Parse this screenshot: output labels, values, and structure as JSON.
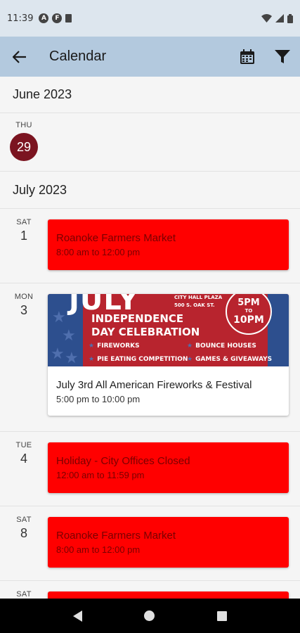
{
  "status": {
    "time": "11:39",
    "icons": [
      "a-icon",
      "f-icon",
      "sim-icon"
    ],
    "right_icons": [
      "wifi-icon",
      "signal-icon",
      "battery-icon"
    ]
  },
  "app_bar": {
    "title": "Calendar",
    "icons": [
      "back-arrow-icon",
      "calendar-icon",
      "filter-icon"
    ]
  },
  "colors": {
    "app_bar": "#b3c9de",
    "today": "#7b1420",
    "event": "#ff0000",
    "event_text": "#7a0000"
  },
  "june": {
    "month": "June 2023",
    "days": [
      {
        "dow": "THU",
        "day": "29",
        "today": true
      }
    ]
  },
  "july": {
    "month": "July 2023",
    "days": [
      {
        "dow": "SAT",
        "day": "1",
        "events": [
          {
            "title": "Roanoke Farmers Market",
            "time": "8:00 am to 12:00 pm"
          }
        ]
      },
      {
        "dow": "MON",
        "day": "3",
        "events": [
          {
            "title": "July 3rd All American Fireworks & Festival",
            "time": "5:00 pm to 10:00 pm",
            "banner": {
              "big": "JULY",
              "line1": "INDEPENDENCE",
              "line2": "DAY CELEBRATION",
              "location1": "CITY HALL PLAZA",
              "location2": "500 S. OAK ST.",
              "time_top": "5PM",
              "time_mid": "TO",
              "time_bot": "10PM",
              "items": [
                "FIREWORKS",
                "BOUNCE HOUSES",
                "PIE EATING COMPETITION",
                "GAMES & GIVEAWAYS"
              ]
            }
          }
        ]
      },
      {
        "dow": "TUE",
        "day": "4",
        "events": [
          {
            "title": "Holiday - City Offices Closed",
            "time": "12:00 am to 11:59 pm"
          }
        ]
      },
      {
        "dow": "SAT",
        "day": "8",
        "events": [
          {
            "title": "Roanoke Farmers Market",
            "time": "8:00 am to 12:00 pm"
          }
        ]
      },
      {
        "dow": "SAT",
        "day": "",
        "events": [
          {
            "title": "",
            "time": ""
          }
        ]
      }
    ]
  },
  "nav": {
    "icons": [
      "nav-back-icon",
      "nav-home-icon",
      "nav-recents-icon"
    ]
  }
}
